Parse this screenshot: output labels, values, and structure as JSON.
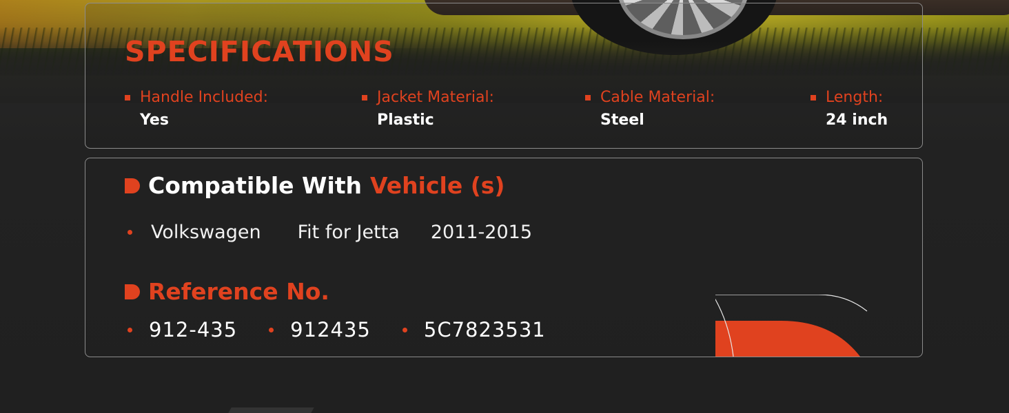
{
  "specifications": {
    "title": "SPECIFICATIONS",
    "items": [
      {
        "label": "Handle Included:",
        "value": "Yes"
      },
      {
        "label": "Jacket Material:",
        "value": "Plastic"
      },
      {
        "label": "Cable Material:",
        "value": "Steel"
      },
      {
        "label": "Length:",
        "value": "24 inch"
      }
    ]
  },
  "compatibility": {
    "heading_white": "Compatible With ",
    "heading_red": "Vehicle (s)",
    "make": "Volkswagen",
    "model": "Fit for Jetta",
    "years": "2011-2015"
  },
  "reference": {
    "heading": "Reference No.",
    "numbers": [
      "912-435",
      "912435",
      "5C7823531"
    ]
  },
  "colors": {
    "accent": "#e0421f",
    "background": "#202020",
    "text": "#ffffff"
  }
}
